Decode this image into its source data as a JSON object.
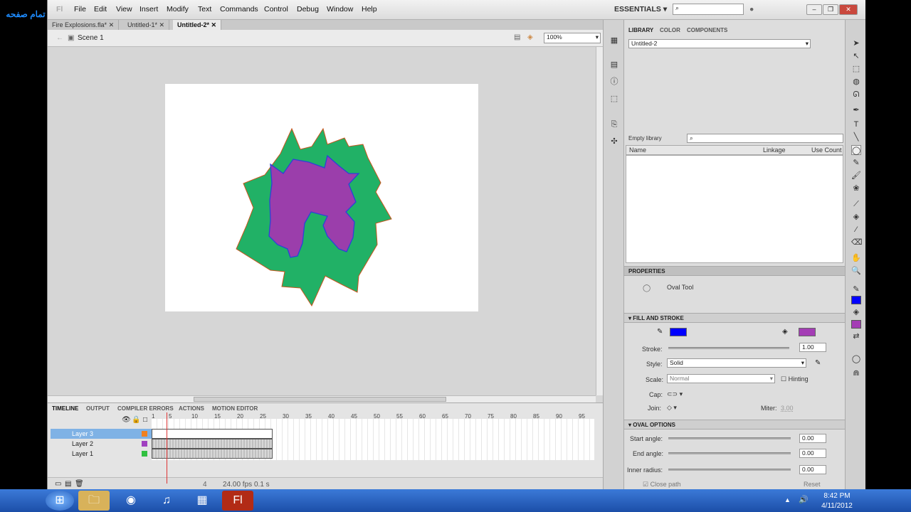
{
  "overlay_text": "تمام صفحه",
  "menu": [
    "File",
    "Edit",
    "View",
    "Insert",
    "Modify",
    "Text",
    "Commands",
    "Control",
    "Debug",
    "Window",
    "Help"
  ],
  "workspace": "ESSENTIALS",
  "doc_tabs": [
    "Fire Explosions.fla*",
    "Untitled-1*",
    "Untitled-2*"
  ],
  "scene": "Scene 1",
  "zoom": "100%",
  "timeline": {
    "tabs": [
      "TIMELINE",
      "OUTPUT",
      "COMPILER ERRORS",
      "ACTIONS",
      "MOTION EDITOR"
    ],
    "ruler": [
      "1",
      "5",
      "10",
      "15",
      "20",
      "25",
      "30",
      "35",
      "40",
      "45",
      "50",
      "55",
      "60",
      "65",
      "70",
      "75",
      "80",
      "85",
      "90",
      "95"
    ],
    "layers": [
      "Layer 3",
      "Layer 2",
      "Layer 1"
    ],
    "fps": "24.00 fps",
    "time": "0.1 s",
    "frame": "4"
  },
  "library": {
    "tabs": [
      "LIBRARY",
      "COLOR",
      "COMPONENTS"
    ],
    "doc": "Untitled-2",
    "empty": "Empty library",
    "cols": [
      "Name",
      "Linkage",
      "Use Count"
    ]
  },
  "properties": {
    "title": "PROPERTIES",
    "tool": "Oval Tool",
    "fill_stroke": "FILL AND STROKE",
    "stroke_label": "Stroke:",
    "stroke_val": "1.00",
    "style_label": "Style:",
    "style_val": "Solid",
    "scale_label": "Scale:",
    "scale_val": "Normal",
    "hinting": "Hinting",
    "cap": "Cap:",
    "join": "Join:",
    "miter": "Miter:",
    "miter_val": "3.00",
    "oval_options": "OVAL OPTIONS",
    "start_angle": "Start angle:",
    "start_val": "0.00",
    "end_angle": "End angle:",
    "end_val": "0.00",
    "inner_radius": "Inner radius:",
    "inner_val": "0.00",
    "close_path": "Close path",
    "reset": "Reset",
    "stroke_color": "#0000ff",
    "fill_color": "#a43db5"
  },
  "clock": {
    "time": "8:42 PM",
    "date": "4/11/2012"
  }
}
